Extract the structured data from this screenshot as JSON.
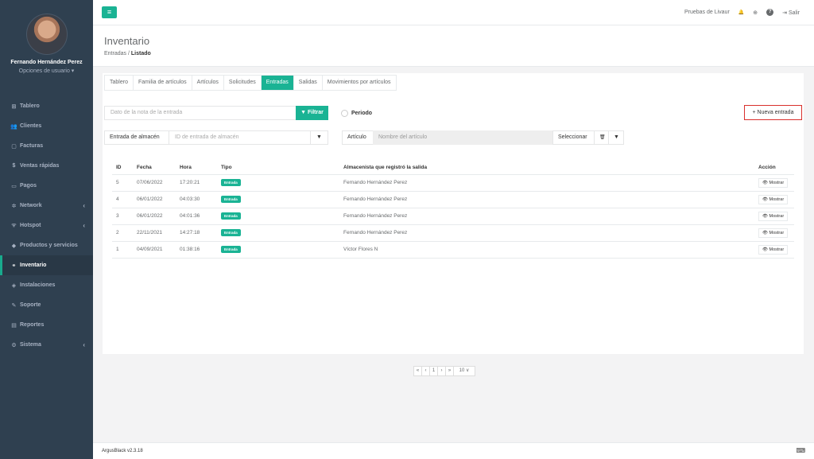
{
  "user": {
    "name": "Fernando Hernández Perez",
    "options": "Opciones de usuario ▾"
  },
  "sidebar": {
    "items": [
      {
        "label": "Tablero",
        "icon": "⊞"
      },
      {
        "label": "Clientes",
        "icon": "👥"
      },
      {
        "label": "Facturas",
        "icon": "▢"
      },
      {
        "label": "Ventas rápidas",
        "icon": "$"
      },
      {
        "label": "Pagos",
        "icon": "▭"
      },
      {
        "label": "Network",
        "icon": "✲",
        "arrow": "‹"
      },
      {
        "label": "Hotspot",
        "icon": "ᯤ",
        "arrow": "‹"
      },
      {
        "label": "Productos y servicios",
        "icon": "◆"
      },
      {
        "label": "Inventario",
        "icon": "⚭"
      },
      {
        "label": "Instalaciones",
        "icon": "◈"
      },
      {
        "label": "Soporte",
        "icon": "✎"
      },
      {
        "label": "Reportes",
        "icon": "▤"
      },
      {
        "label": "Sistema",
        "icon": "⚙",
        "arrow": "‹"
      }
    ]
  },
  "topbar": {
    "menu_icon": "≡",
    "company": "Pruebas de Livaur",
    "bell": "🔔",
    "grid": "⊕",
    "help": "?",
    "logout_icon": "⇥",
    "logout": "Salir"
  },
  "header": {
    "title": "Inventario",
    "crumb_parent": "Entradas",
    "crumb_sep": " / ",
    "crumb_current": "Listado"
  },
  "tabs": [
    "Tablero",
    "Familia de artículos",
    "Artículos",
    "Solicitudes",
    "Entradas",
    "Salidas",
    "Movimientos por artículos"
  ],
  "filters": {
    "note_placeholder": "Dato de la nota de la entrada",
    "filter_btn": "▼ Filtrar",
    "period_label": "Periodo",
    "new_entry": "+ Nueva entrada",
    "warehouse_label": "Entrada de almacén",
    "warehouse_placeholder": "ID de entrada de almacén",
    "funnel": "▼",
    "article_label": "Artículo",
    "article_placeholder": "Nombre del artículo",
    "select_btn": "Seleccionar",
    "trash": "🗑"
  },
  "table": {
    "headers": [
      "ID",
      "Fecha",
      "Hora",
      "Tipo",
      "Almacenista que registró la salida",
      "Acción"
    ],
    "rows": [
      {
        "id": "5",
        "fecha": "07/06/2022",
        "hora": "17:20:21",
        "tipo": "Entrada",
        "almacenista": "Fernando Hernández Perez",
        "accion": "👁 Mostrar"
      },
      {
        "id": "4",
        "fecha": "06/01/2022",
        "hora": "04:03:30",
        "tipo": "Entrada",
        "almacenista": "Fernando Hernández Perez",
        "accion": "👁 Mostrar"
      },
      {
        "id": "3",
        "fecha": "06/01/2022",
        "hora": "04:01:36",
        "tipo": "Entrada",
        "almacenista": "Fernando Hernández Perez",
        "accion": "👁 Mostrar"
      },
      {
        "id": "2",
        "fecha": "22/11/2021",
        "hora": "14:27:18",
        "tipo": "Entrada",
        "almacenista": "Fernando Hernández Perez",
        "accion": "👁 Mostrar"
      },
      {
        "id": "1",
        "fecha": "04/09/2021",
        "hora": "01:38:16",
        "tipo": "Entrada",
        "almacenista": "Víctor Flores N",
        "accion": "👁 Mostrar"
      }
    ]
  },
  "pagination": {
    "first": "«",
    "prev": "‹",
    "page": "1",
    "next": "›",
    "last": "»",
    "size": "10 ∨"
  },
  "footer": {
    "version": "ArgusBlack v2.3.18",
    "icon": "⌨"
  }
}
